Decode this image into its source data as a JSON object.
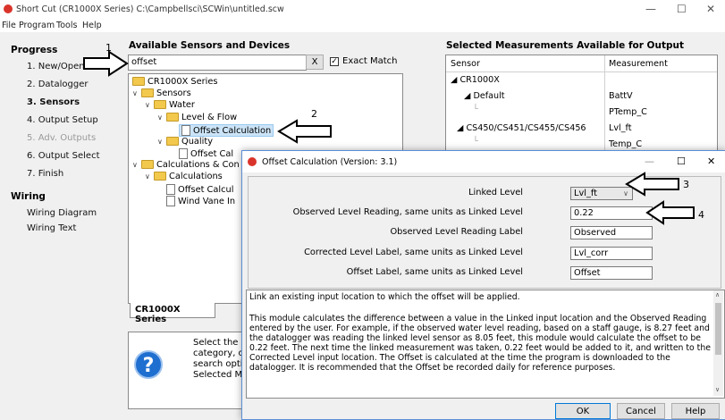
{
  "window": {
    "title": "Short Cut (CR1000X Series) C:\\Campbellsci\\SCWin\\untitled.scw",
    "minimize": "—",
    "maximize": "☐",
    "close": "✕"
  },
  "menu": [
    "File",
    "Program",
    "Tools",
    "Help"
  ],
  "nav": {
    "progress_heading": "Progress",
    "steps": [
      "1. New/Open",
      "2. Datalogger",
      "3. Sensors",
      "4. Output Setup",
      "5. Adv. Outputs",
      "6. Output Select",
      "7. Finish"
    ],
    "wiring_heading": "Wiring",
    "wiring_items": [
      "Wiring Diagram",
      "Wiring Text"
    ]
  },
  "sensors_panel": {
    "title": "Available Sensors and Devices",
    "search_value": "offset",
    "clear_label": "X",
    "exact_match_label": "Exact Match",
    "exact_match_checked": true,
    "tree": {
      "root": "CR1000X Series",
      "sensors": "Sensors",
      "water": "Water",
      "level_flow": "Level & Flow",
      "offset_calc_1": "Offset Calculation",
      "quality": "Quality",
      "offset_calc_2": "Offset Cal",
      "calc_con": "Calculations & Con",
      "calculations": "Calculations",
      "offset_calc_3": "Offset Calcul",
      "wind_vane": "Wind Vane In"
    },
    "tab_label": "CR1000X Series",
    "help_text_lines": [
      "Select the",
      "category, o",
      "search opti",
      "Selected M"
    ]
  },
  "output_panel": {
    "title": "Selected Measurements Available for Output",
    "columns": [
      "Sensor",
      "Measurement"
    ],
    "rows": [
      {
        "sensor": "CR1000X",
        "measurement": ""
      },
      {
        "sensor": "Default",
        "measurement": "BattV"
      },
      {
        "sensor": "",
        "measurement": "PTemp_C"
      },
      {
        "sensor": "CS450/CS451/CS455/CS456",
        "measurement": "Lvl_ft"
      },
      {
        "sensor": "",
        "measurement": "Temp_C"
      }
    ]
  },
  "dialog": {
    "title": "Offset Calculation (Version: 3.1)",
    "minimize": "—",
    "maximize": "☐",
    "close": "✕",
    "fields": {
      "linked_level_label": "Linked Level",
      "linked_level_value": "Lvl_ft",
      "observed_reading_label": "Observed Level Reading, same units as Linked Level",
      "observed_reading_value": "0.22",
      "observed_label_label": "Observed Level Reading Label",
      "observed_label_value": "Observed",
      "corrected_label_label": "Corrected Level Label, same units as Linked Level",
      "corrected_label_value": "Lvl_corr",
      "offset_label_label": "Offset Label, same units as Linked Level",
      "offset_label_value": "Offset"
    },
    "description_intro": "Link an existing input location to which the offset will be applied.",
    "description_body": "This module calculates the difference between a value in the Linked input location and the Observed Reading entered by the user. For example, if the observed water level reading, based on a staff gauge, is 8.27 feet and the datalogger was reading the linked level sensor as 8.05 feet, this module would calculate the offset to be 0.22 feet. The next time the linked measurement was taken, 0.22 feet would be added to it, and written to the Corrected Level input location.  The Offset is calculated at the time the program is downloaded to the datalogger. It is recommended that the Offset be recorded daily for reference purposes.",
    "buttons": {
      "ok": "OK",
      "cancel": "Cancel",
      "help": "Help"
    }
  },
  "annotations": [
    "1",
    "2",
    "3",
    "4"
  ]
}
